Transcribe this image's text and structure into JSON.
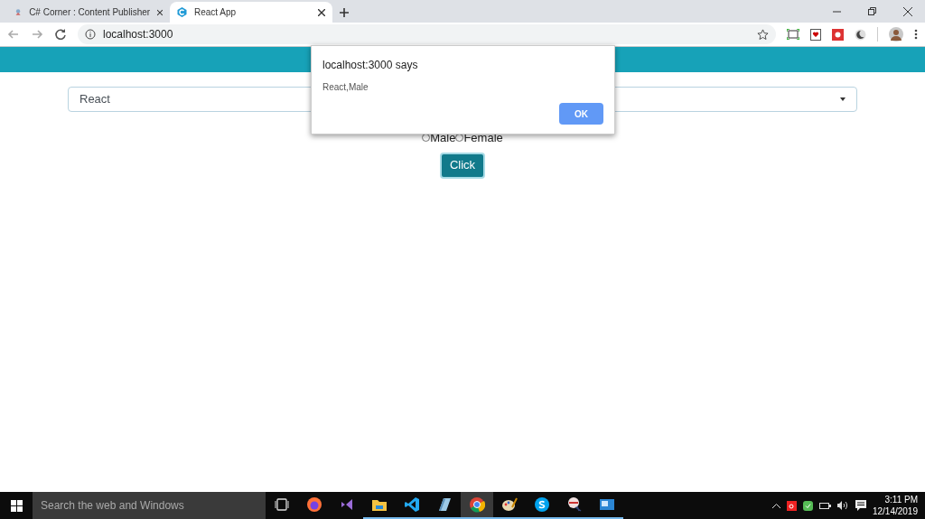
{
  "browser": {
    "tabs": [
      {
        "title": "C# Corner : Content Publisher",
        "selected": false
      },
      {
        "title": "React App",
        "selected": true
      }
    ],
    "address": "localhost:3000"
  },
  "page": {
    "select": {
      "value": "React"
    },
    "radios": [
      {
        "label": "Male",
        "checked": false
      },
      {
        "label": "Female",
        "checked": false
      }
    ],
    "button": "Click"
  },
  "dialog": {
    "title": "localhost:3000 says",
    "message": "React,Male",
    "ok": "OK"
  },
  "taskbar": {
    "search_placeholder": "Search the web and Windows",
    "apps": [
      {
        "kind": "taskview",
        "running": false,
        "selected": false
      },
      {
        "kind": "firefox",
        "running": false,
        "selected": false
      },
      {
        "kind": "vstudio",
        "running": false,
        "selected": false
      },
      {
        "kind": "explorer",
        "running": true,
        "selected": false
      },
      {
        "kind": "vscode",
        "running": true,
        "selected": false
      },
      {
        "kind": "notes",
        "running": true,
        "selected": false
      },
      {
        "kind": "chrome",
        "running": true,
        "selected": true
      },
      {
        "kind": "paint",
        "running": true,
        "selected": false
      },
      {
        "kind": "skype",
        "running": true,
        "selected": false
      },
      {
        "kind": "snip",
        "running": true,
        "selected": false
      },
      {
        "kind": "remote",
        "running": true,
        "selected": false
      }
    ],
    "time": "3:11 PM",
    "date": "12/14/2019"
  }
}
